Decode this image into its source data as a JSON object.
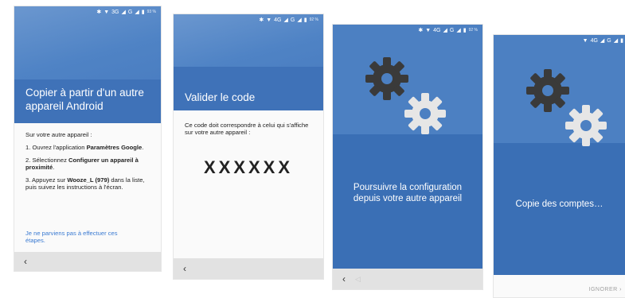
{
  "screens": [
    {
      "status": {
        "network": "3G",
        "signal": "G",
        "battery_pct": "93 %"
      },
      "title": "Copier à partir d'un autre appareil Android",
      "intro": "Sur votre autre appareil :",
      "steps": [
        {
          "prefix": "1. Ouvrez l'application ",
          "bold": "Paramètres Google",
          "suffix": "."
        },
        {
          "prefix": "2. Sélectionnez ",
          "bold": "Configurer un appareil à proximité",
          "suffix": "."
        },
        {
          "prefix": "3. Appuyez sur ",
          "bold": "Wooze_L (979)",
          "suffix": " dans la liste, puis suivez les instructions à l'écran."
        }
      ],
      "help_link": "Je ne parviens pas à effectuer ces étapes.",
      "nav_back": "‹"
    },
    {
      "status": {
        "network": "4G",
        "signal": "G",
        "battery_pct": "92 %"
      },
      "title": "Valider le code",
      "message": "Ce code doit correspondre à celui qui s'affiche sur votre autre appareil :",
      "code": "XXXXXX",
      "nav_back": "‹"
    },
    {
      "status": {
        "network": "4G",
        "signal": "G",
        "battery_pct": "92 %"
      },
      "message": "Poursuivre la configuration depuis votre autre appareil",
      "nav_back": "‹",
      "nav_home": "◁"
    },
    {
      "status": {
        "network": "4G",
        "signal": "G"
      },
      "message": "Copie des comptes…",
      "skip_label": "IGNORER ›"
    }
  ],
  "colors": {
    "header_blue": "#4f83c5",
    "band_blue": "#3f72b8",
    "gear_dark": "#3a3a3a",
    "gear_light": "#e6e6e6",
    "link_blue": "#3b7bd2",
    "navbar_gray": "#e2e2e2"
  },
  "icons": [
    "bluetooth-icon",
    "wifi-icon",
    "signal-icon",
    "battery-icon",
    "back-icon",
    "gear-icon"
  ]
}
